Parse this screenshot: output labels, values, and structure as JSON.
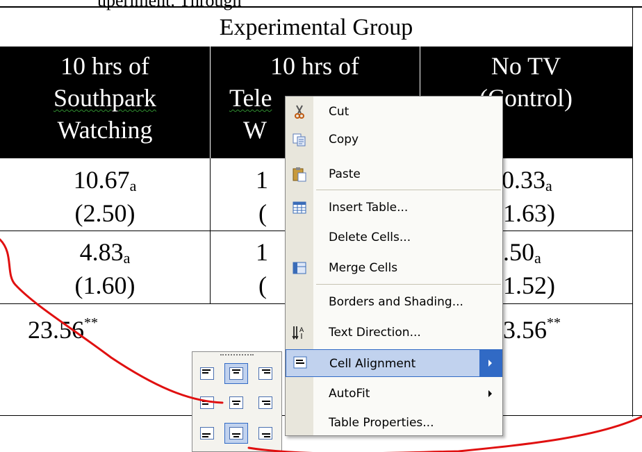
{
  "document": {
    "caption_fragment": "uperiment. Through",
    "group_title": "Experimental Group",
    "columns": [
      {
        "lines": [
          "10 hrs of",
          "Southpark",
          "Watching"
        ]
      },
      {
        "lines": [
          "10 hrs of",
          "Tele",
          "W"
        ]
      },
      {
        "lines": [
          "No TV",
          "(Control)"
        ]
      }
    ],
    "rows": [
      {
        "c1": [
          "10.67",
          "a"
        ],
        "c1b": "(2.50)",
        "c2": "1",
        "c2b": "(",
        "c3": [
          "0.33",
          "a"
        ],
        "c3b": "1.63)"
      },
      {
        "c1": [
          "4.83",
          "a"
        ],
        "c1b": "(1.60)",
        "c2": "1",
        "c2b": "(",
        "c3": [
          ".50",
          "a"
        ],
        "c3b": "1.52)"
      },
      {
        "c1": [
          "23.56",
          "**"
        ],
        "c3": [
          "3.56",
          "**"
        ]
      }
    ]
  },
  "context_menu": {
    "items": [
      {
        "label": "Cut",
        "icon": "scissors-icon"
      },
      {
        "label": "Copy",
        "icon": "copy-icon"
      },
      {
        "label": "Paste",
        "icon": "paste-icon"
      },
      {
        "label": "Insert Table...",
        "icon": "insert-table-icon"
      },
      {
        "label": "Delete Cells...",
        "icon": ""
      },
      {
        "label": "Merge Cells",
        "icon": "merge-cells-icon"
      },
      {
        "label": "Borders and Shading...",
        "icon": ""
      },
      {
        "label": "Text Direction...",
        "icon": "text-direction-icon"
      },
      {
        "label": "Cell Alignment",
        "icon": "cell-alignment-icon",
        "submenu": true,
        "highlighted": true
      },
      {
        "label": "AutoFit",
        "icon": "",
        "submenu": true
      },
      {
        "label": "Table Properties...",
        "icon": ""
      }
    ]
  },
  "alignment_palette": {
    "options": [
      "align-top-left",
      "align-top-center",
      "align-top-right",
      "align-middle-left",
      "align-middle-center",
      "align-middle-right",
      "align-bottom-left",
      "align-bottom-center",
      "align-bottom-right"
    ],
    "selected": [
      "align-top-center",
      "align-bottom-center"
    ]
  },
  "annotation": {
    "color": "#e01010"
  },
  "colors": {
    "menu_highlight": "#c1d2ee",
    "menu_highlight_border": "#316ac5"
  }
}
